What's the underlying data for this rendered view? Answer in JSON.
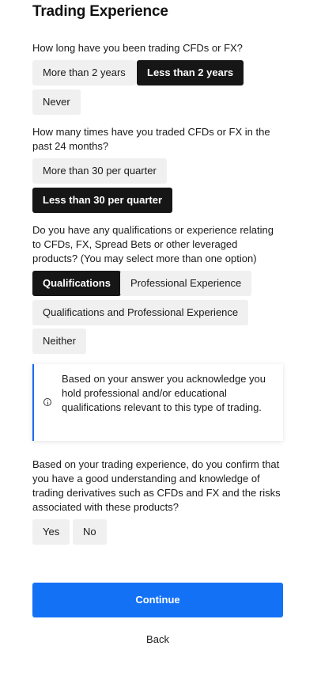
{
  "title": "Trading Experience",
  "q1": {
    "question": "How long have you been trading CFDs or FX?",
    "options": [
      "More than 2 years",
      "Less than 2 years",
      "Never"
    ],
    "selected": "Less than 2 years"
  },
  "q2": {
    "question": "How many times have you traded CFDs or FX in the past 24 months?",
    "options": [
      "More than 30 per quarter",
      "Less than 30 per quarter"
    ],
    "selected": "Less than 30 per quarter"
  },
  "q3": {
    "question": "Do you have any qualifications or experience relating to CFDs, FX, Spread Bets or other leveraged products? (You may select more than one option)",
    "options": [
      "Qualifications",
      "Professional Experience",
      "Qualifications and Professional Experience",
      "Neither"
    ],
    "selected": "Qualifications"
  },
  "info": {
    "icon": "info-circle-icon",
    "text": "Based on your answer you acknowledge you hold professional and/or educational qualifications relevant to this type of trading.",
    "accent_color": "#1a6cf0"
  },
  "q4": {
    "question": "Based on your trading experience, do you confirm that you have a good understanding and knowledge of trading derivatives such as CFDs and FX and the risks associated with these products?",
    "options": [
      "Yes",
      "No"
    ]
  },
  "actions": {
    "continue_label": "Continue",
    "back_label": "Back",
    "primary_color": "#1371f6"
  }
}
